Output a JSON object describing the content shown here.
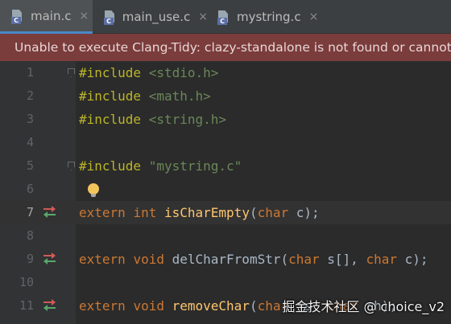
{
  "tabs": [
    {
      "label": "main.c",
      "active": true,
      "icon": "c-file-icon",
      "close": "×"
    },
    {
      "label": "main_use.c",
      "active": false,
      "icon": "c-file-icon",
      "close": "×"
    },
    {
      "label": "mystring.c",
      "active": false,
      "icon": "c-file-icon",
      "close": "×"
    }
  ],
  "file_icon_badge": "C",
  "banner": {
    "text": "Unable to execute Clang-Tidy: clazy-standalone is not found or cannot be executed"
  },
  "editor": {
    "current_line": 7,
    "lines": [
      {
        "num": "1",
        "include": "#include",
        "path": "<stdio.h>"
      },
      {
        "num": "2",
        "include": "#include",
        "path": "<math.h>"
      },
      {
        "num": "3",
        "include": "#include",
        "path": "<string.h>"
      },
      {
        "num": "4"
      },
      {
        "num": "5",
        "include": "#include",
        "path": "\"mystring.c\""
      },
      {
        "num": "6"
      },
      {
        "num": "7",
        "kw1": "extern",
        "kw2": "int",
        "fname": "isCharEmpty",
        "open": "(",
        "p1type": "char",
        "p1": " c",
        "close": ");"
      },
      {
        "num": "8"
      },
      {
        "num": "9",
        "kw1": "extern",
        "kw2": "void",
        "fname": "delCharFromStr",
        "open": "(",
        "p1type": "char",
        "p1": " s[], ",
        "p2type": "char",
        "p2": " c",
        "close": ");"
      },
      {
        "num": "10"
      },
      {
        "num": "11",
        "kw1": "extern",
        "kw2": "void",
        "fname": "removeChar",
        "open": "(",
        "p1type": "char",
        "p1": " *s, ",
        "p2type": "char",
        "p2": " ch",
        "close": ");"
      }
    ]
  },
  "watermark": "掘金技术社区 @ choice_v2"
}
